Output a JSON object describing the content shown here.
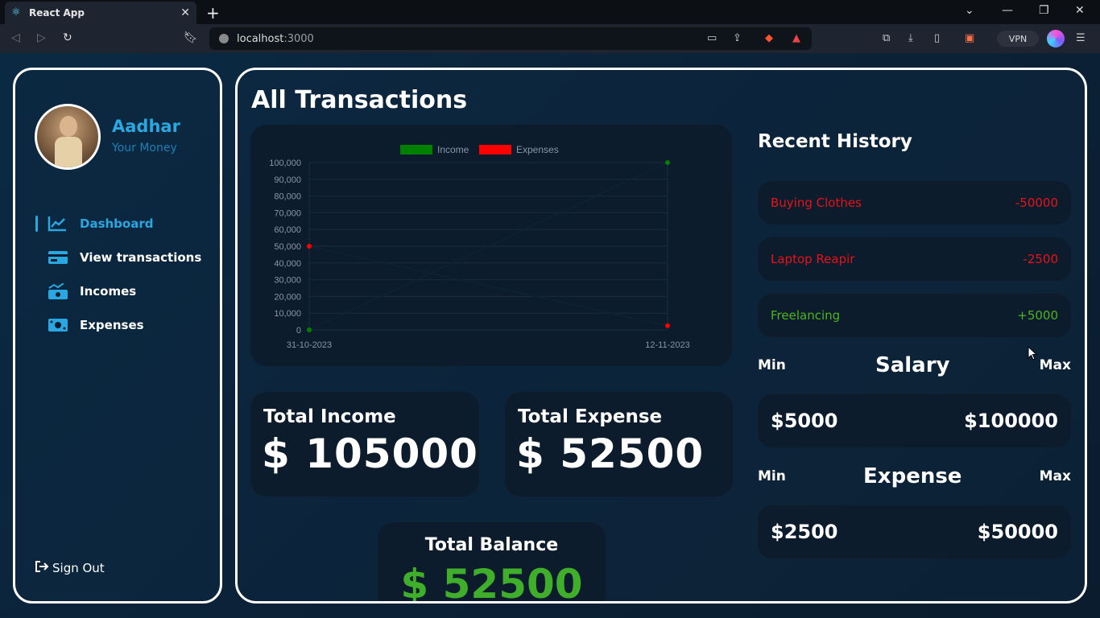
{
  "browser": {
    "tab_title": "React App",
    "url_host": "localhost",
    "url_port": ":3000",
    "vpn_label": "VPN"
  },
  "sidebar": {
    "username": "Aadhar",
    "tagline": "Your Money",
    "menu": [
      {
        "label": "Dashboard",
        "icon": "chart-line-icon",
        "active": true
      },
      {
        "label": "View transactions",
        "icon": "credit-card-icon",
        "active": false
      },
      {
        "label": "Incomes",
        "icon": "money-bill-trend-icon",
        "active": false
      },
      {
        "label": "Expenses",
        "icon": "money-bill-icon",
        "active": false
      }
    ],
    "signout_label": "Sign Out"
  },
  "main": {
    "title": "All Transactions",
    "total_income_label": "Total Income",
    "total_income_value": "$ 105000",
    "total_expense_label": "Total Expense",
    "total_expense_value": "$ 52500",
    "total_balance_label": "Total Balance",
    "total_balance_value": "$ 52500"
  },
  "history": {
    "title": "Recent History",
    "items": [
      {
        "name": "Buying Clothes",
        "amount": "-50000",
        "type": "expense"
      },
      {
        "name": "Laptop Reapir",
        "amount": "-2500",
        "type": "expense"
      },
      {
        "name": "Freelancing",
        "amount": "+5000",
        "type": "income"
      }
    ]
  },
  "salary": {
    "min_label": "Min",
    "title": "Salary",
    "max_label": "Max",
    "min_value": "$5000",
    "max_value": "$100000"
  },
  "expense_range": {
    "min_label": "Min",
    "title": "Expense",
    "max_label": "Max",
    "min_value": "$2500",
    "max_value": "$50000"
  },
  "colors": {
    "accent": "#2aa7e0",
    "income": "#008000",
    "expense": "#ff0000",
    "balance": "#3fae2a"
  },
  "chart_data": {
    "type": "line",
    "x": [
      "31-10-2023",
      "12-11-2023"
    ],
    "series": [
      {
        "name": "Income",
        "values": [
          0,
          100000
        ],
        "color": "#008000"
      },
      {
        "name": "Expenses",
        "values": [
          50000,
          2500
        ],
        "color": "#ff0000"
      }
    ],
    "ylim": [
      0,
      100000
    ],
    "yticks": [
      "100,000",
      "90,000",
      "80,000",
      "70,000",
      "60,000",
      "50,000",
      "40,000",
      "30,000",
      "20,000",
      "10,000",
      "0"
    ],
    "legend": "top",
    "grid": true
  }
}
